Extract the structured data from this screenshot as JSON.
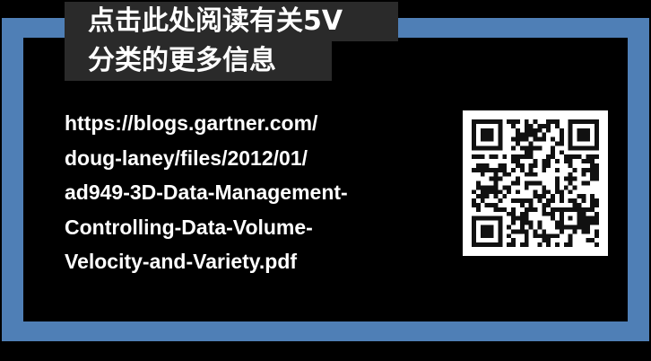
{
  "title": {
    "line1": "点击此处阅读有关5V",
    "line2": "分类的更多信息"
  },
  "link": {
    "lines": [
      "https://blogs.gartner.com/",
      "doug-laney/files/2012/01/",
      "ad949-3D-Data-Management-",
      "Controlling-Data-Volume-",
      "Velocity-and-Variety.pdf"
    ]
  },
  "colors": {
    "frame": "#4f7fb6",
    "background": "#000000",
    "title_bg": "#2a2a2a",
    "text": "#ffffff"
  },
  "qr": {
    "icon": "qr-code-icon"
  }
}
